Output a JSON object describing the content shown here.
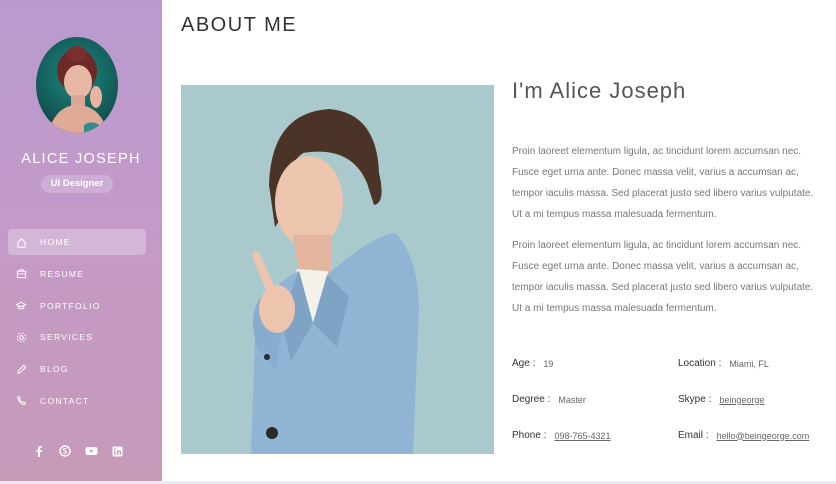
{
  "profile": {
    "name": "ALICE JOSEPH",
    "role": "UI Designer",
    "avatar_icon": "woman-portrait-avatar"
  },
  "nav": {
    "items": [
      {
        "label": "HOME",
        "icon": "home-icon",
        "active": true
      },
      {
        "label": "RESUME",
        "icon": "briefcase-icon",
        "active": false
      },
      {
        "label": "PORTFOLIO",
        "icon": "graduation-cap-icon",
        "active": false
      },
      {
        "label": "SERVICES",
        "icon": "gear-icon",
        "active": false
      },
      {
        "label": "BLOG",
        "icon": "pencil-icon",
        "active": false
      },
      {
        "label": "CONTACT",
        "icon": "phone-icon",
        "active": false
      }
    ]
  },
  "socials": [
    "facebook-icon",
    "skype-icon",
    "youtube-icon",
    "linkedin-icon"
  ],
  "about": {
    "title": "ABOUT ME",
    "headline": "I'm Alice Joseph",
    "paragraphs": [
      "Proin laoreet elementum ligula, ac tincidunt lorem accumsan nec. Fusce eget urna ante. Donec massa velit, varius a accumsan ac, tempor iaculis massa. Sed placerat justo sed libero varius vulputate. Ut a mi tempus massa malesuada fermentum.",
      "Proin laoreet elementum ligula, ac tincidunt lorem accumsan nec. Fusce eget urna ante. Donec massa velit, varius a accumsan ac, tempor iaculis massa. Sed placerat justo sed libero varius vulputate. Ut a mi tempus massa malesuada fermentum."
    ],
    "info": {
      "age": {
        "label": "Age :",
        "value": "19"
      },
      "location": {
        "label": "Location :",
        "value": "Miami, FL"
      },
      "degree": {
        "label": "Degree :",
        "value": "Master"
      },
      "skype": {
        "label": "Skype :",
        "value": "beingeorge"
      },
      "phone": {
        "label": "Phone :",
        "value": "098-765-4321"
      },
      "email": {
        "label": "Email :",
        "value": "hello@beingeorge.com"
      }
    }
  },
  "colors": {
    "sidebar_top": "#b99ad0",
    "sidebar_bottom": "#c79ab8",
    "photo_background": "#a9c9cd",
    "blazer": "#8fb4d4"
  }
}
